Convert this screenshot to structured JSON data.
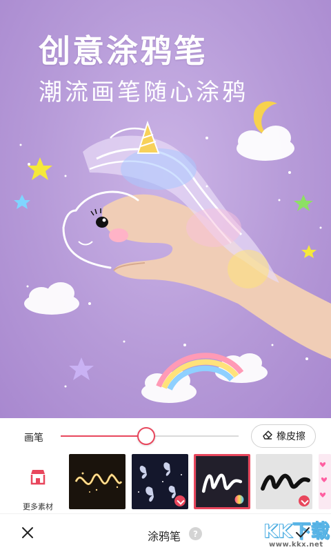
{
  "hero": {
    "title": "创意涂鸦笔",
    "subtitle": "潮流画笔随心涂鸦"
  },
  "brush": {
    "label": "画笔",
    "size_fraction": 0.48,
    "eraser_label": "橡皮擦",
    "eraser_icon": "eraser-icon"
  },
  "materials": {
    "more_label": "更多素材",
    "more_icon": "store-icon",
    "items": [
      {
        "name": "sparkle-brush",
        "selected": false,
        "downloadable": false
      },
      {
        "name": "butterfly-brush",
        "selected": false,
        "downloadable": true
      },
      {
        "name": "neon-brush",
        "selected": true,
        "downloadable": false
      },
      {
        "name": "marker-brush",
        "selected": false,
        "downloadable": true
      },
      {
        "name": "hearts-brush",
        "selected": false,
        "downloadable": true
      }
    ]
  },
  "bottom_bar": {
    "title": "涂鸦笔",
    "help_glyph": "?",
    "close_icon": "close-icon",
    "confirm_icon": "check-icon"
  },
  "watermark": {
    "brand": "KK下载",
    "url": "www.kkx.net"
  },
  "colors": {
    "accent": "#e8465c",
    "hero_bg": "#b69ad8"
  }
}
